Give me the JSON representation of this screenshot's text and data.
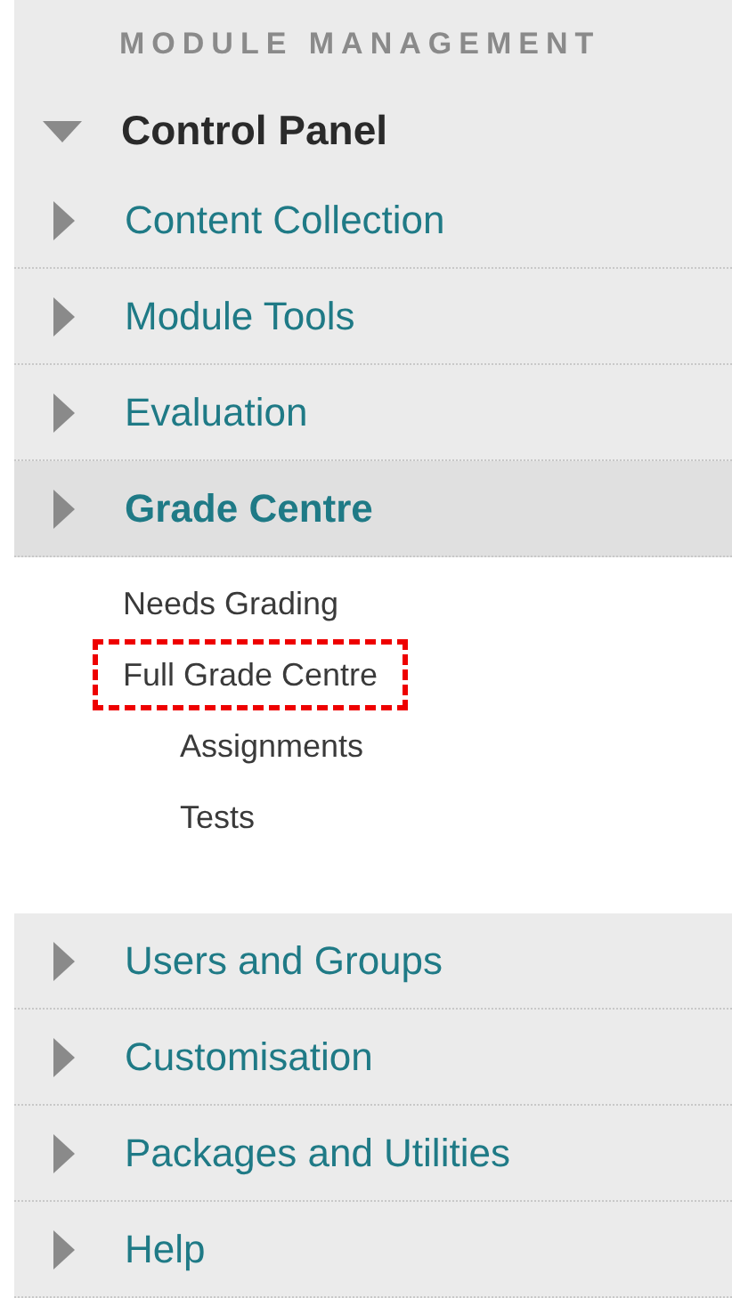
{
  "heading": "MODULE MANAGEMENT",
  "control_panel": {
    "label": "Control Panel",
    "expanded": true
  },
  "sections": [
    {
      "label": "Content Collection",
      "selected": false
    },
    {
      "label": "Module Tools",
      "selected": false
    },
    {
      "label": "Evaluation",
      "selected": false
    },
    {
      "label": "Grade Centre",
      "selected": true,
      "children": [
        {
          "label": "Needs Grading",
          "highlighted": false
        },
        {
          "label": "Full Grade Centre",
          "highlighted": true,
          "children": [
            {
              "label": "Assignments",
              "highlighted": false
            },
            {
              "label": "Tests",
              "highlighted": false
            }
          ]
        }
      ]
    },
    {
      "label": "Users and Groups",
      "selected": false
    },
    {
      "label": "Customisation",
      "selected": false
    },
    {
      "label": "Packages and Utilities",
      "selected": false
    },
    {
      "label": "Help",
      "selected": false
    }
  ]
}
